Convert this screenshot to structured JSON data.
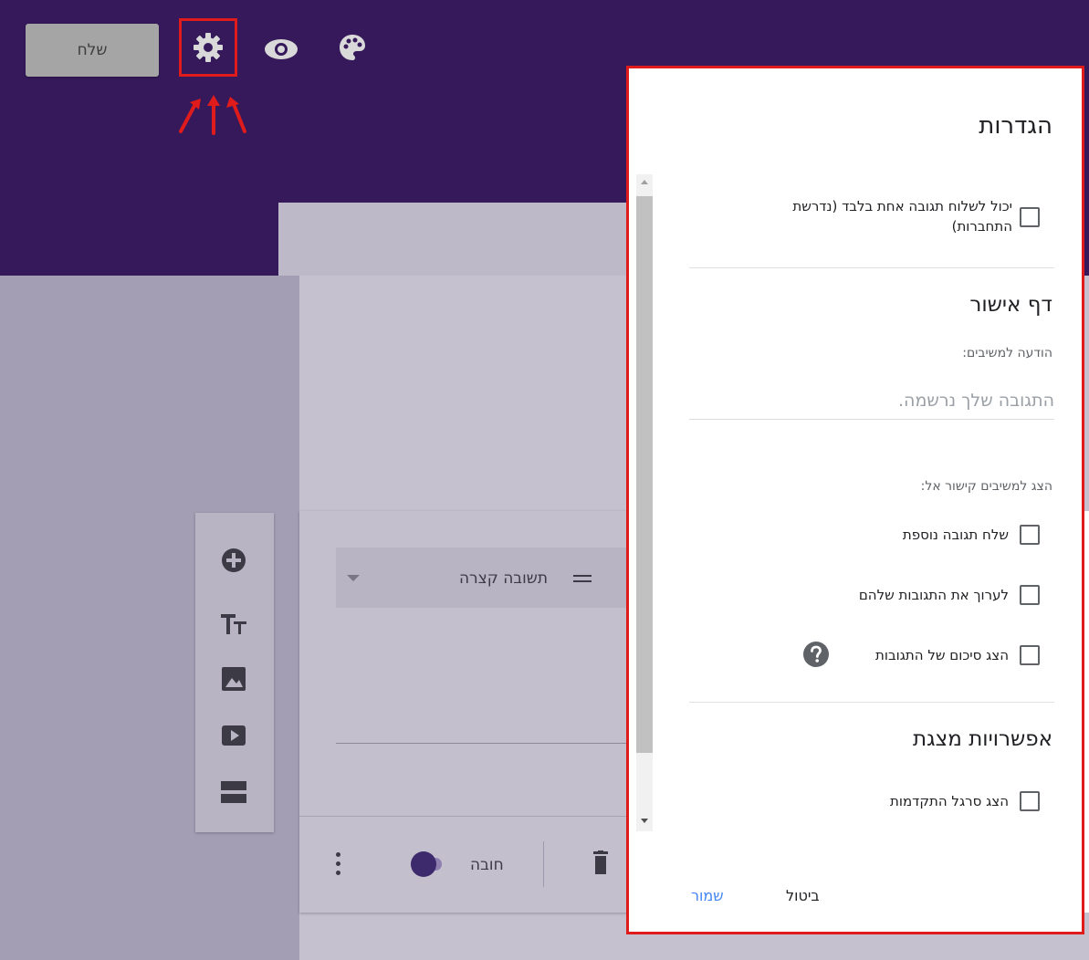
{
  "colors": {
    "header_purple": "#35195b",
    "highlight_red": "#e01b1b",
    "link_blue": "#4285f4"
  },
  "header": {
    "send_label": "שלח",
    "icons": [
      "gear-icon",
      "eye-icon",
      "palette-icon"
    ]
  },
  "question_card": {
    "type_label": "תשובה קצרה",
    "required_label": "חובה",
    "required_on": true,
    "toolbox_icons": [
      "add-circle-icon",
      "title-icon",
      "image-icon",
      "video-icon",
      "section-icon"
    ]
  },
  "settings": {
    "title": "הגדרות",
    "one_response_label": "יכול לשלוח תגובה אחת בלבד (נדרשת התחברות)",
    "confirmation_title": "דף אישור",
    "message_label": "הודעה למשיבים:",
    "message_placeholder": "התגובה שלך נרשמה.",
    "links_label": "הצג למשיבים קישור אל:",
    "options": [
      "שלח תגובה נוספת",
      "לערוך את התגובות שלהם",
      "הצג סיכום של התגובות"
    ],
    "presentation_title": "אפשרויות מצגת",
    "progress_label": "הצג סרגל התקדמות",
    "cancel_label": "ביטול",
    "save_label": "שמור"
  }
}
